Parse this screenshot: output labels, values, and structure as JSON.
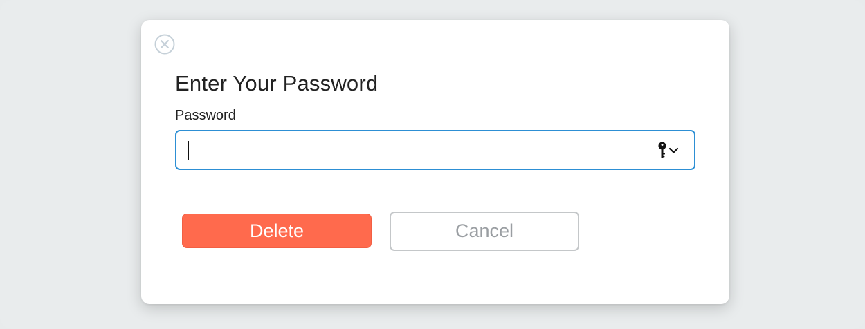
{
  "dialog": {
    "title": "Enter Your Password",
    "password_label": "Password",
    "password_value": "",
    "password_placeholder": "",
    "delete_label": "Delete",
    "cancel_label": "Cancel"
  },
  "icons": {
    "close": "close-circle-icon",
    "keychain": "key-icon",
    "dropdown": "chevron-down-icon"
  },
  "colors": {
    "delete_button": "#ff6a4d",
    "input_focus_border": "#2d8fd4",
    "cancel_text": "#9a9ea2"
  }
}
